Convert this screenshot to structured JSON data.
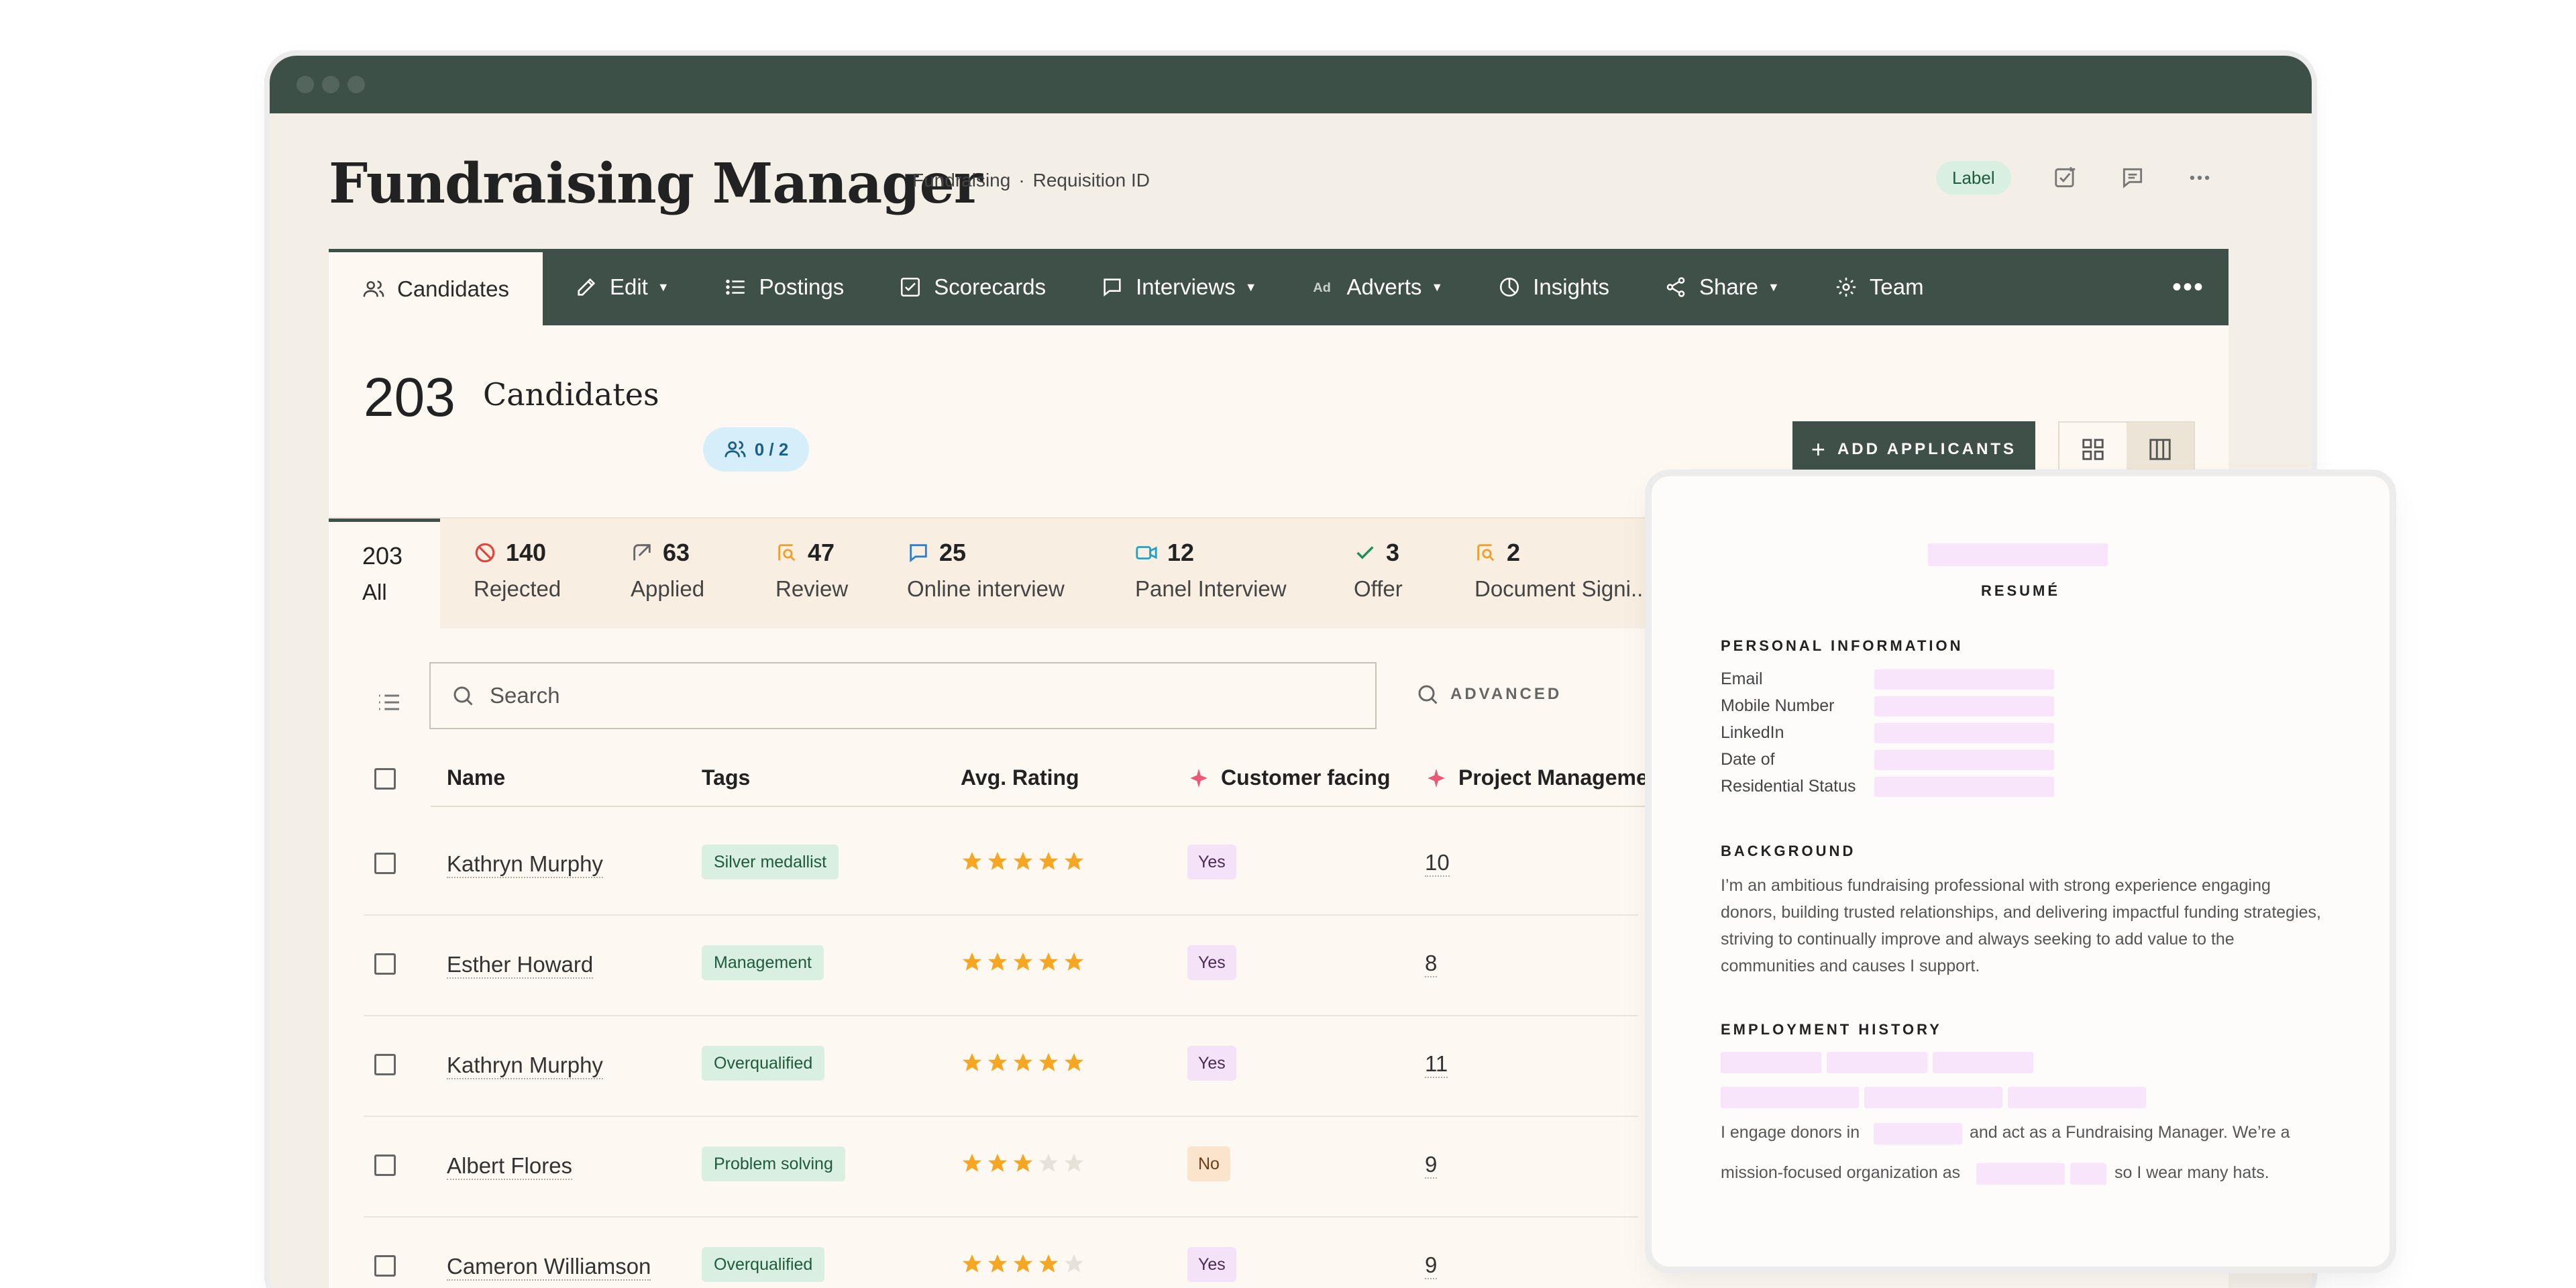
{
  "window": {
    "title": "Fundraising Manager",
    "breadcrumb": [
      "Fundraising",
      "Requisition ID"
    ],
    "label_chip": "Label"
  },
  "nav": {
    "items": [
      {
        "label": "Candidates",
        "icon": "users-icon",
        "caret": false,
        "active": true
      },
      {
        "label": "Edit",
        "icon": "edit-icon",
        "caret": true
      },
      {
        "label": "Postings",
        "icon": "list-icon",
        "caret": false
      },
      {
        "label": "Scorecards",
        "icon": "checkbox-icon",
        "caret": false
      },
      {
        "label": "Interviews",
        "icon": "chat-icon",
        "caret": true
      },
      {
        "label": "Adverts",
        "icon": "ad-icon",
        "caret": true
      },
      {
        "label": "Insights",
        "icon": "pie-icon",
        "caret": false
      },
      {
        "label": "Share",
        "icon": "share-icon",
        "caret": true
      },
      {
        "label": "Team",
        "icon": "gear-icon",
        "caret": false
      }
    ],
    "more": "•••"
  },
  "candidates": {
    "count": "203",
    "label": "Candidates",
    "team_badge": "0 / 2",
    "add_button": "ADD APPLICANTS"
  },
  "stages": [
    {
      "count": "203",
      "label": "All"
    },
    {
      "count": "140",
      "label": "Rejected",
      "icon": "rejected-icon"
    },
    {
      "count": "63",
      "label": "Applied",
      "icon": "applied-icon"
    },
    {
      "count": "47",
      "label": "Review",
      "icon": "review-icon"
    },
    {
      "count": "25",
      "label": "Online interview",
      "icon": "chat-icon"
    },
    {
      "count": "12",
      "label": "Panel Interview",
      "icon": "video-icon"
    },
    {
      "count": "3",
      "label": "Offer",
      "icon": "check-icon"
    },
    {
      "count": "2",
      "label": "Document Signi...",
      "icon": "document-icon"
    }
  ],
  "search": {
    "placeholder": "Search",
    "advanced": "ADVANCED",
    "filter": "F"
  },
  "table": {
    "columns": [
      "Name",
      "Tags",
      "Avg. Rating",
      "Customer facing",
      "Project Managemen"
    ],
    "rows": [
      {
        "name": "Kathryn Murphy",
        "tag": "Silver medallist",
        "rating": 5,
        "customer_facing": "Yes",
        "score": "10"
      },
      {
        "name": "Esther Howard",
        "tag": "Management",
        "rating": 5,
        "customer_facing": "Yes",
        "score": "8"
      },
      {
        "name": "Kathryn Murphy",
        "tag": "Overqualified",
        "rating": 5,
        "customer_facing": "Yes",
        "score": "11"
      },
      {
        "name": "Albert Flores",
        "tag": "Problem solving",
        "rating": 3,
        "customer_facing": "No",
        "score": "9"
      },
      {
        "name": "Cameron Williamson",
        "tag": "Overqualified",
        "rating": 4,
        "customer_facing": "Yes",
        "score": "9"
      }
    ]
  },
  "resume": {
    "title": "RESUMÉ",
    "personal_heading": "PERSONAL INFORMATION",
    "personal_fields": [
      "Email",
      "Mobile Number",
      "LinkedIn",
      "Date of",
      "Residential Status"
    ],
    "background_heading": "BACKGROUND",
    "background_text": "I’m an ambitious fundraising professional with strong experience engaging donors, building trusted relationships, and delivering impactful funding strategies, striving to continually improve and always seeking to add value to the communities and causes I support.",
    "employment_heading": "EMPLOYMENT HISTORY",
    "line1_a": "I engage donors in",
    "line1_b": "and act as a Fundraising Manager. We’re a",
    "line2_a": "mission-focused organization as",
    "line2_b": "so I wear many hats."
  },
  "colors": {
    "dark_green": "#3f5048",
    "cream": "#fdf8f1",
    "tag_green": "#d9efe2",
    "star": "#f5a623",
    "pink_redaction": "#f8e4fb"
  }
}
